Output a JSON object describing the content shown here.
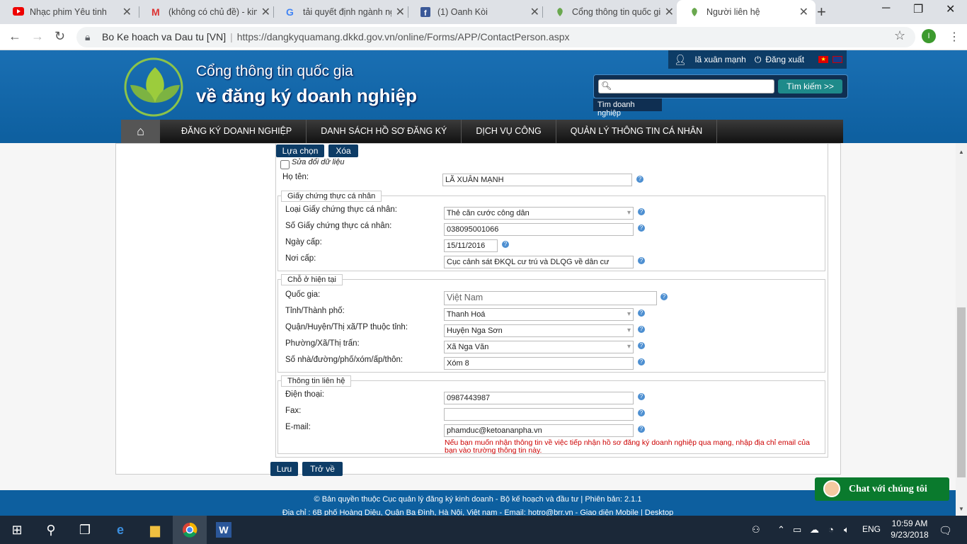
{
  "browser": {
    "tabs": [
      {
        "title": "Nhạc phim Yêu tinh",
        "icon": "youtube-icon"
      },
      {
        "title": "(không có chủ đề) - kim",
        "icon": "gmail-icon"
      },
      {
        "title": "tải quyết định ngành ng",
        "icon": "google-icon"
      },
      {
        "title": "(1) Oanh Kòi",
        "icon": "facebook-icon"
      },
      {
        "title": "Cổng thông tin quốc gia",
        "icon": "site-leaf-icon"
      },
      {
        "title": "Người liên hệ",
        "icon": "site-leaf-icon"
      }
    ],
    "site_label": "Bo Ke hoach va Dau tu [VN]",
    "url": "https://dangkyquamang.dkkd.gov.vn/online/Forms/APP/ContactPerson.aspx",
    "profile_initial": "I"
  },
  "header": {
    "title_line1": "Cổng thông tin quốc gia",
    "title_line2": "về đăng ký doanh nghiệp",
    "user_name": "lã xuân mạnh",
    "logout": "Đăng xuất",
    "search_placeholder": "",
    "search_button": "Tìm kiếm >>",
    "search_tip": "Tìm doanh nghiệp"
  },
  "menu": [
    "ĐĂNG KÝ DOANH NGHIỆP",
    "DANH SÁCH HỒ SƠ ĐĂNG KÝ",
    "DỊCH VỤ CÔNG",
    "QUẢN LÝ THÔNG TIN CÁ NHÂN"
  ],
  "form": {
    "select_btn": "Lựa chọn",
    "delete_btn": "Xóa",
    "edit_checkbox": "Sửa đổi dữ liệu",
    "name_label": "Họ tên:",
    "name_value": "LÃ XUÂN MẠNH",
    "id_group": "Giấy chứng thực cá nhân",
    "id_type_label": "Loại Giấy chứng thực cá nhân:",
    "id_type_value": "Thẻ căn cước công dân",
    "id_number_label": "Số Giấy chứng thực cá nhân:",
    "id_number_value": "038095001066",
    "issue_date_label": "Ngày cấp:",
    "issue_date_value": "15/11/2016",
    "issue_place_label": "Nơi cấp:",
    "issue_place_value": "Cục cảnh sát ĐKQL cư trú và DLQG về dân cư",
    "address_group": "Chỗ ở hiện tại",
    "country_label": "Quốc gia:",
    "country_value": "Việt Nam",
    "province_label": "Tỉnh/Thành phố:",
    "province_value": "Thanh Hoá",
    "district_label": "Quận/Huyện/Thị xã/TP thuộc tỉnh:",
    "district_value": "Huyện Nga Sơn",
    "ward_label": "Phường/Xã/Thị trấn:",
    "ward_value": "Xã Nga Văn",
    "street_label": "Số nhà/đường/phố/xóm/ấp/thôn:",
    "street_value": "Xóm 8",
    "contact_group": "Thông tin liên hệ",
    "phone_label": "Điện thoại:",
    "phone_value": "0987443987",
    "fax_label": "Fax:",
    "fax_value": "",
    "email_label": "E-mail:",
    "email_value": "phamduc@ketoananpha.vn",
    "email_note": "Nếu bạn muốn nhận thông tin về việc tiếp nhận hồ sơ đăng ký doanh nghiệp qua mạng, nhập địa chỉ email của bạn vào trường thông tin này.",
    "save_btn": "Lưu",
    "back_btn": "Trở về"
  },
  "footer": {
    "line1": "© Bản quyền thuộc Cục quản lý đăng ký kinh doanh - Bộ kế hoạch và đầu tư | Phiên bản: 2.1.1",
    "line2": "Địa chỉ : 6B phố Hoàng Diệu, Quận Ba Đình, Hà Nội, Việt nam - Email: hotro@brr.vn - Giao diện Mobile | Desktop",
    "chat": "Chat với chúng tôi"
  },
  "taskbar": {
    "lang": "ENG",
    "time": "10:59 AM",
    "date": "9/23/2018"
  }
}
